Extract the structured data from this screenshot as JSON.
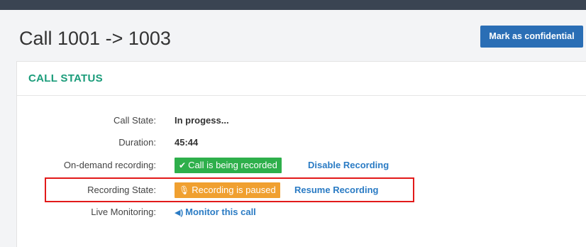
{
  "header": {
    "title": "Call 1001 -> 1003",
    "confidential_button": "Mark as confidential"
  },
  "panel": {
    "title": "CALL STATUS"
  },
  "rows": {
    "call_state": {
      "label": "Call State:",
      "value": "In progess..."
    },
    "duration": {
      "label": "Duration:",
      "value": "45:44"
    },
    "on_demand": {
      "label": "On-demand recording:",
      "badge": "Call is being recorded",
      "badge_icon": "check-icon",
      "action": "Disable Recording"
    },
    "recording_state": {
      "label": "Recording State:",
      "badge": "Recording is paused",
      "badge_icon": "microphone-slash-icon",
      "action": "Resume Recording"
    },
    "live_monitoring": {
      "label": "Live Monitoring:",
      "action": "Monitor this call",
      "action_icon": "speaker-icon"
    }
  },
  "colors": {
    "accent_title": "#1a9c7a",
    "button_blue": "#2a6eb5",
    "link_blue": "#2a7bc4",
    "badge_green": "#2eaf4b",
    "badge_orange": "#f0a030",
    "highlight_red": "#e21a1a",
    "topbar": "#3a4452"
  }
}
